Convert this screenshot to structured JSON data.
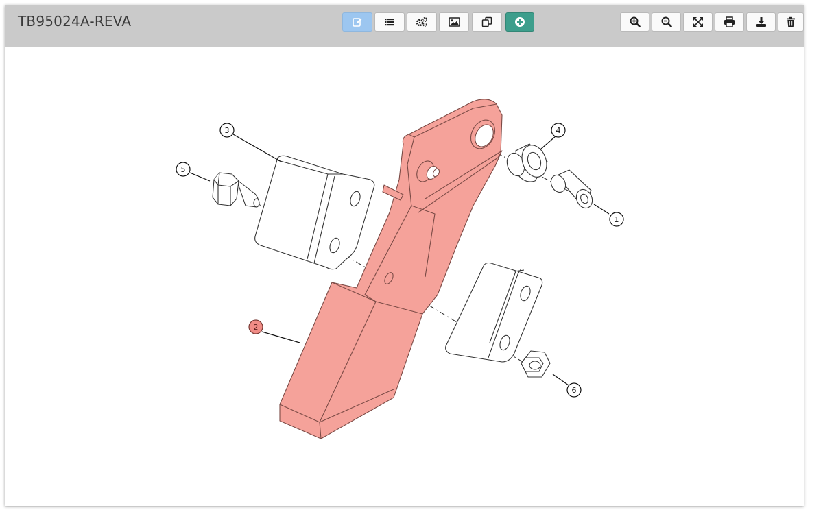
{
  "header": {
    "title": "TB95024A-REVA"
  },
  "toolbar": {
    "left_icons": [
      "edit-icon",
      "list-icon",
      "cogs-icon",
      "image-icon",
      "clone-icon",
      "plus-circle-icon"
    ],
    "right_icons": [
      "zoom-in-icon",
      "zoom-out-icon",
      "fit-to-screen-icon",
      "print-icon",
      "download-icon",
      "trash-icon"
    ],
    "active_color": "#9cc6f0",
    "add_color": "#3d9e8c"
  },
  "drawing": {
    "callouts": [
      {
        "label": "1",
        "highlighted": false
      },
      {
        "label": "2",
        "highlighted": true
      },
      {
        "label": "3",
        "highlighted": false
      },
      {
        "label": "4",
        "highlighted": false
      },
      {
        "label": "5",
        "highlighted": false
      },
      {
        "label": "6",
        "highlighted": false
      }
    ],
    "highlight_color": "#f5a29a"
  }
}
